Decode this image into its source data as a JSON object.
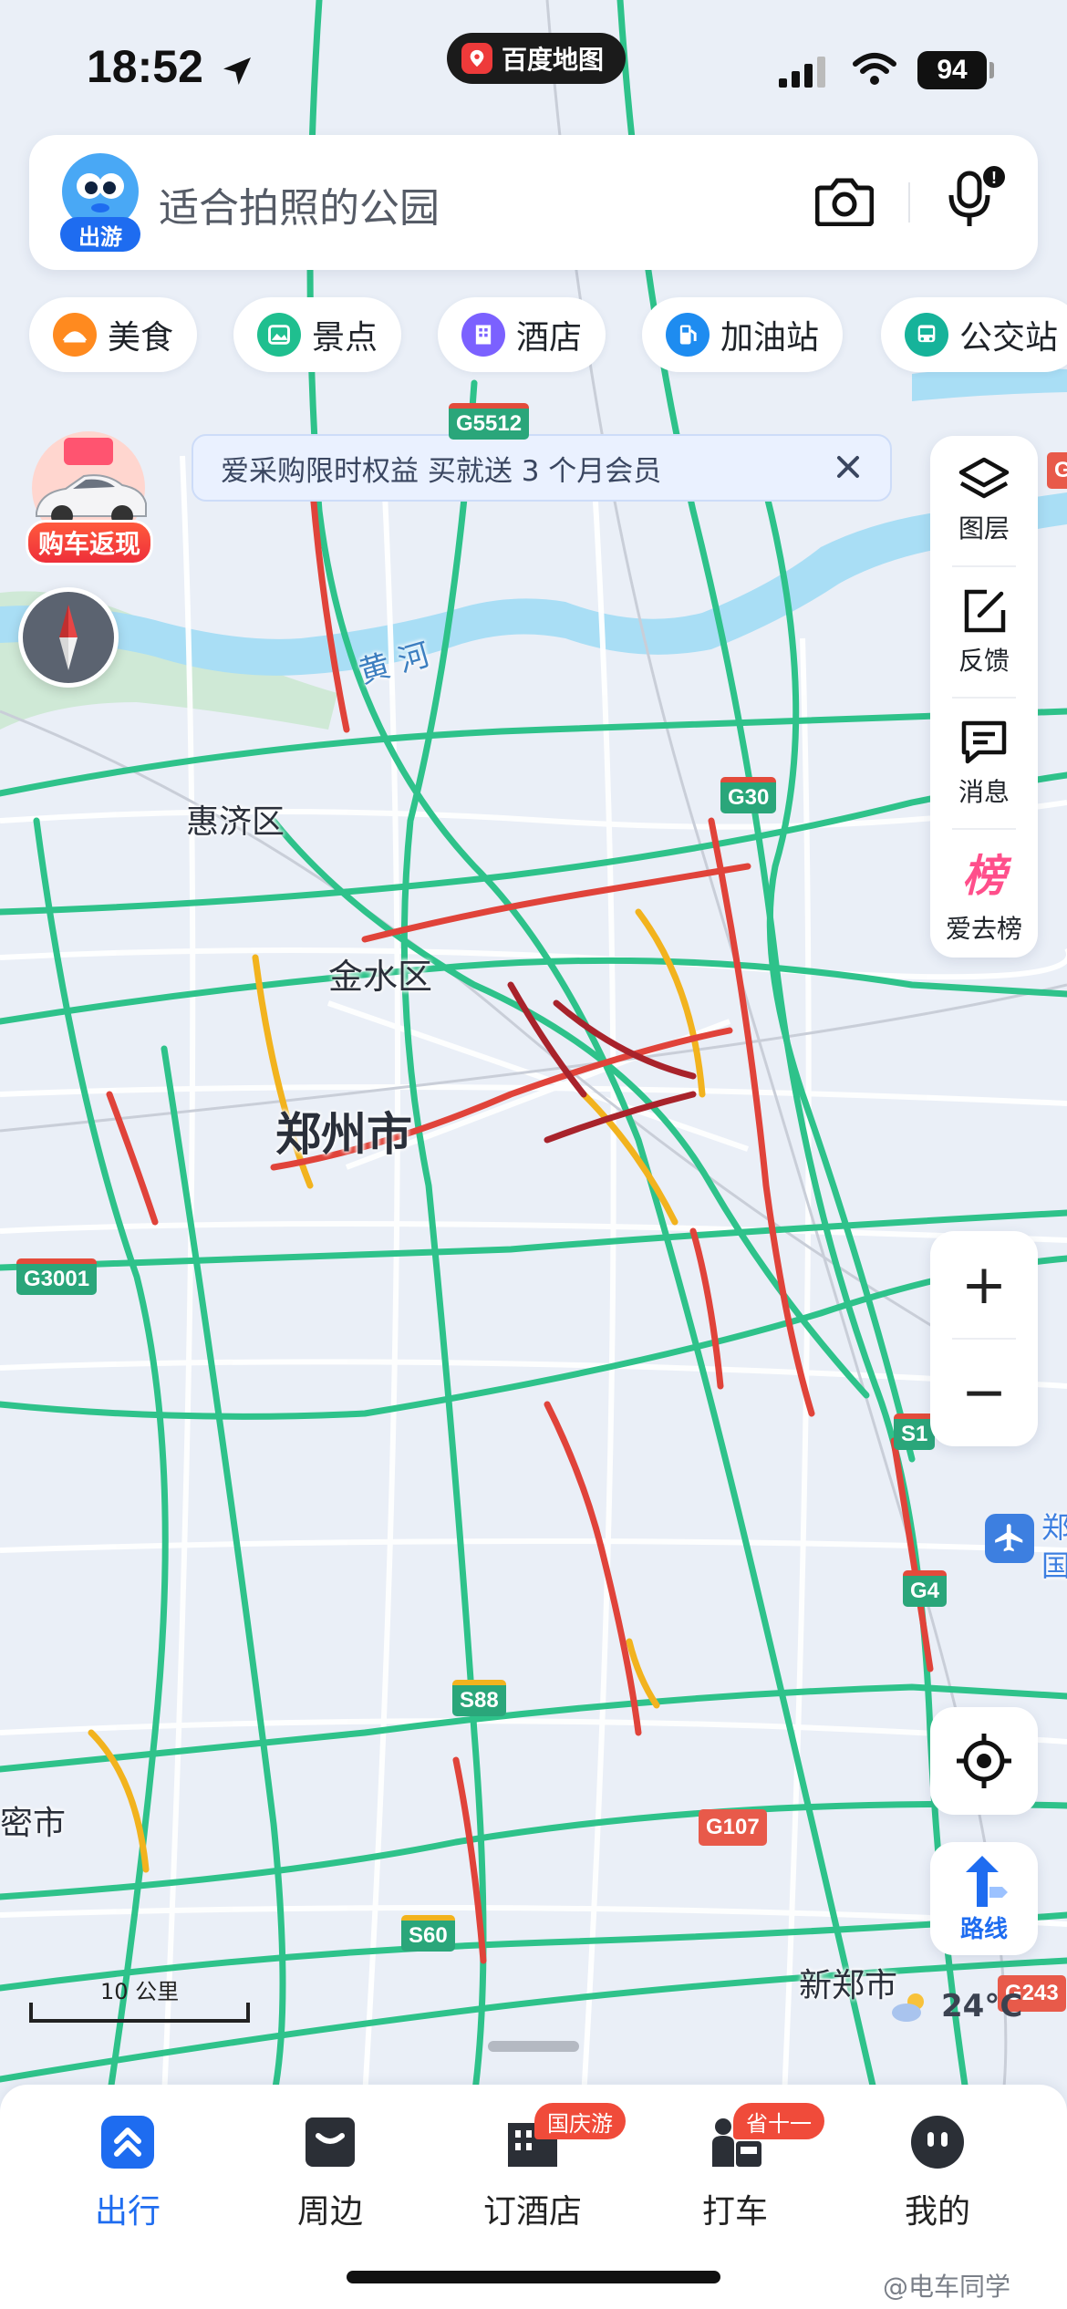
{
  "status_bar": {
    "time": "18:52",
    "app_pill": "百度地图",
    "battery": "94"
  },
  "search": {
    "mascot_tag": "出游",
    "placeholder": "适合拍照的公园"
  },
  "categories": [
    {
      "label": "美食",
      "icon": "food-icon",
      "color": "#ff8a1f"
    },
    {
      "label": "景点",
      "icon": "scenic-icon",
      "color": "#1fbf8f"
    },
    {
      "label": "酒店",
      "icon": "hotel-icon",
      "color": "#7b61ff"
    },
    {
      "label": "加油站",
      "icon": "gas-station-icon",
      "color": "#1e8cf0"
    },
    {
      "label": "公交站",
      "icon": "bus-stop-icon",
      "color": "#16b39a"
    }
  ],
  "promo": {
    "label": "购车返现"
  },
  "notice": {
    "text": "爱采购限时权益 买就送 3 个月会员"
  },
  "tools": [
    {
      "label": "图层",
      "icon": "layers-icon"
    },
    {
      "label": "反馈",
      "icon": "feedback-icon"
    },
    {
      "label": "消息",
      "icon": "message-icon"
    },
    {
      "label": "爱去榜",
      "icon": "ranking-icon"
    }
  ],
  "tool_ranking_glyph": "榜",
  "zoom": {
    "in": "+",
    "out": "−"
  },
  "route_label": "路线",
  "map_labels": {
    "city": "郑州市",
    "district_huiji": "惠济区",
    "district_jinshui": "金水区",
    "river": "黄 河",
    "xinzheng": "新郑市",
    "mi_partial": "密市",
    "airport_partial_1": "郑",
    "airport_partial_2": "国"
  },
  "road_shields": [
    "G5512",
    "G30",
    "G3001",
    "S1",
    "G4",
    "S88",
    "G107",
    "S60",
    "G243",
    "G"
  ],
  "scale": "10 公里",
  "weather": "24°C",
  "tabs": [
    {
      "label": "出行",
      "icon": "travel-icon",
      "active": true
    },
    {
      "label": "周边",
      "icon": "nearby-icon",
      "active": false
    },
    {
      "label": "订酒店",
      "icon": "hotel-booking-icon",
      "active": false,
      "badge": "国庆游"
    },
    {
      "label": "打车",
      "icon": "taxi-icon",
      "active": false,
      "badge": "省十一"
    },
    {
      "label": "我的",
      "icon": "profile-icon",
      "active": false
    }
  ],
  "watermark": "@电车同学",
  "colors": {
    "accent": "#1e6cf0",
    "traffic_green": "#2ec28a",
    "traffic_yellow": "#f2b31e",
    "traffic_red": "#e0433a",
    "water": "#8fd3f4"
  }
}
